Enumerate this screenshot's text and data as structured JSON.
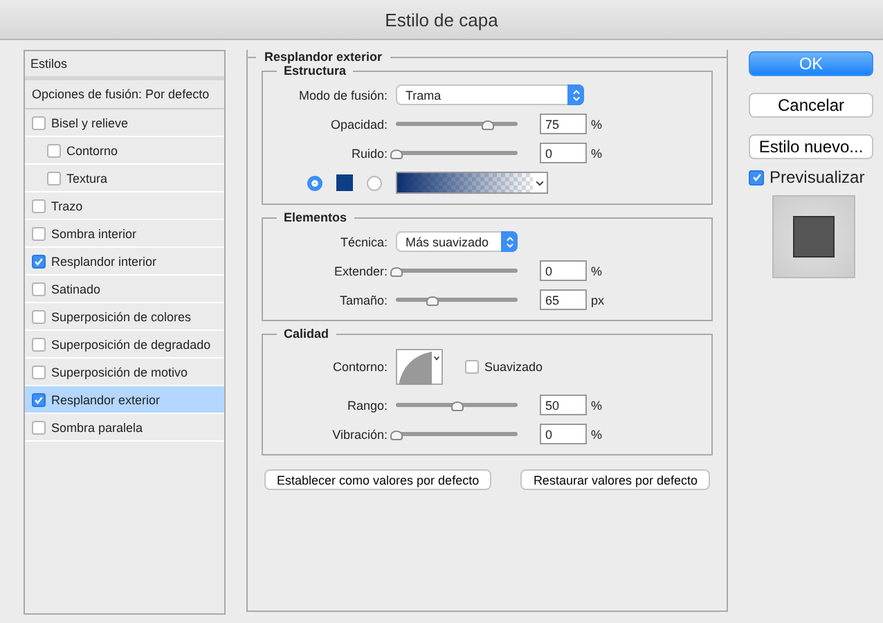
{
  "window": {
    "title": "Estilo de capa"
  },
  "sidebar": {
    "header": "Estilos",
    "blending": "Opciones de fusión: Por defecto",
    "items": [
      {
        "label": "Bisel y relieve",
        "checked": false,
        "selected": false,
        "children": [
          {
            "label": "Contorno",
            "checked": false,
            "selected": false
          },
          {
            "label": "Textura",
            "checked": false,
            "selected": false
          }
        ]
      },
      {
        "label": "Trazo",
        "checked": false,
        "selected": false
      },
      {
        "label": "Sombra interior",
        "checked": false,
        "selected": false
      },
      {
        "label": "Resplandor interior",
        "checked": true,
        "selected": false
      },
      {
        "label": "Satinado",
        "checked": false,
        "selected": false
      },
      {
        "label": "Superposición de colores",
        "checked": false,
        "selected": false
      },
      {
        "label": "Superposición de degradado",
        "checked": false,
        "selected": false
      },
      {
        "label": "Superposición de motivo",
        "checked": false,
        "selected": false
      },
      {
        "label": "Resplandor exterior",
        "checked": true,
        "selected": true
      },
      {
        "label": "Sombra paralela",
        "checked": false,
        "selected": false
      }
    ]
  },
  "panel": {
    "title": "Resplandor exterior",
    "structure": {
      "title": "Estructura",
      "blend_mode": {
        "label": "Modo de fusión:",
        "value": "Trama"
      },
      "sliders": [
        {
          "label": "Opacidad:",
          "level": 0.75,
          "value": "75",
          "unit": "%"
        },
        {
          "label": "Ruido:",
          "level": 0,
          "value": "0",
          "unit": "%"
        }
      ],
      "color_option": {
        "selected": true
      },
      "gradient_option": {
        "selected": false
      }
    },
    "elements": {
      "title": "Elementos",
      "technique": {
        "label": "Técnica:",
        "value": "Más suavizado"
      },
      "sliders": [
        {
          "label": "Extender:",
          "level": 0,
          "value": "0",
          "unit": "%"
        },
        {
          "label": "Tamaño:",
          "level": 0.3,
          "value": "65",
          "unit": "px"
        }
      ]
    },
    "quality": {
      "title": "Calidad",
      "contour_label": "Contorno:",
      "antialias": {
        "label": "Suavizado",
        "checked": false
      },
      "sliders": [
        {
          "label": "Rango:",
          "level": 0.5,
          "value": "50",
          "unit": "%"
        },
        {
          "label": "Vibración:",
          "level": 0,
          "value": "0",
          "unit": "%"
        }
      ]
    },
    "buttons": [
      "Establecer como valores por defecto",
      "Restaurar valores por defecto"
    ]
  },
  "actions": {
    "ok": "OK",
    "cancel": "Cancelar",
    "new_style": "Estilo nuevo...",
    "preview": {
      "label": "Previsualizar",
      "checked": true
    }
  }
}
